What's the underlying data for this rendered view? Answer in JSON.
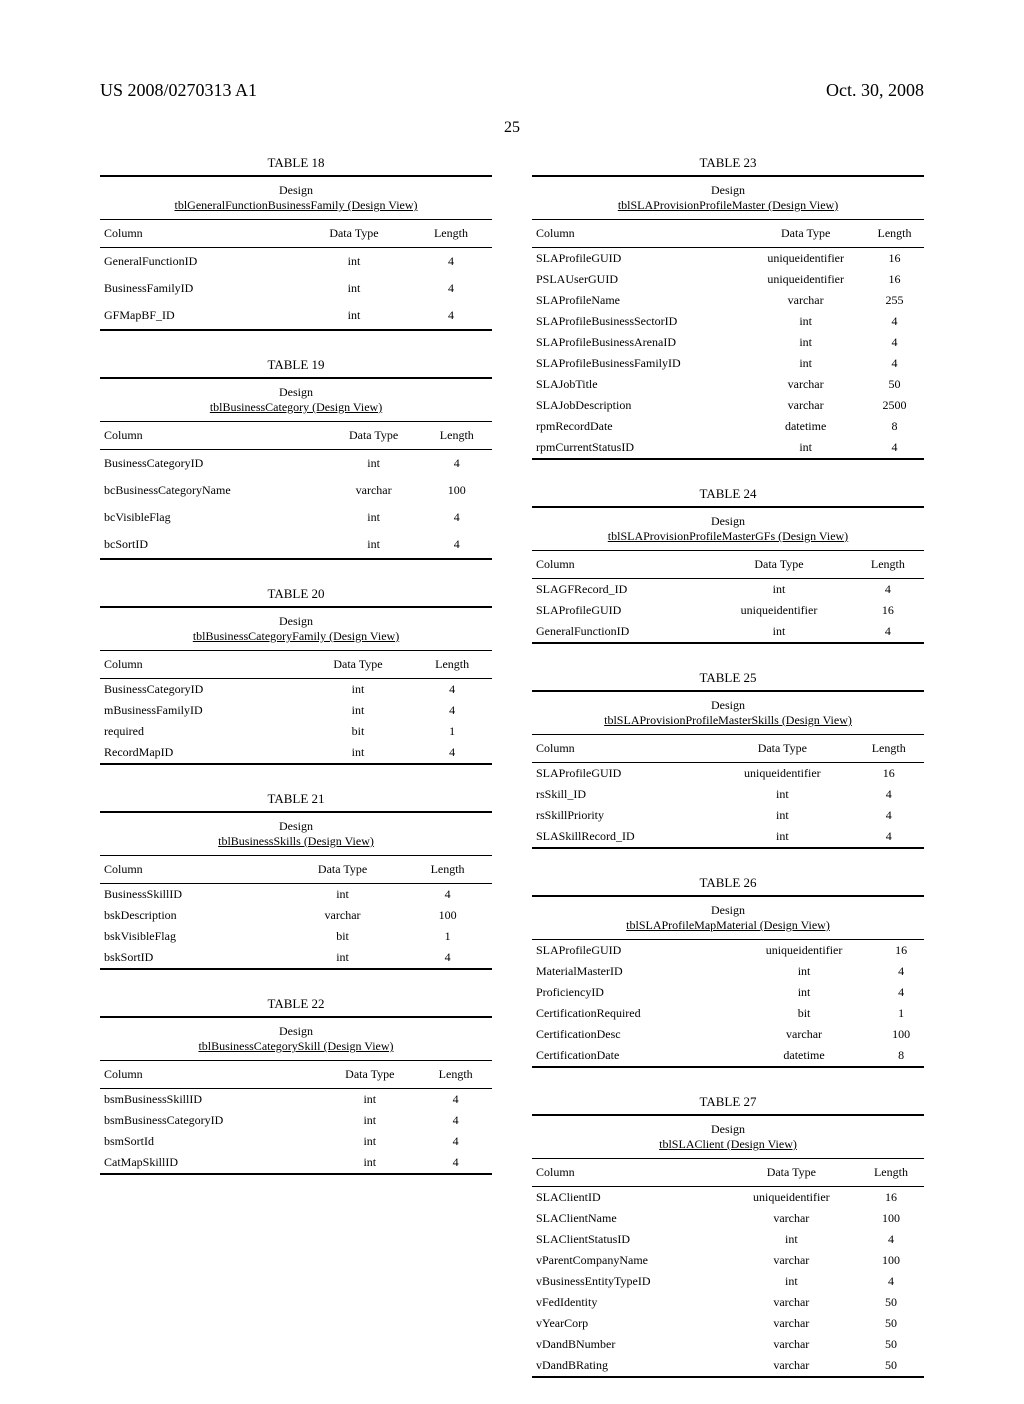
{
  "header": {
    "pub_number": "US 2008/0270313 A1",
    "pub_date": "Oct. 30, 2008",
    "page_number": "25"
  },
  "labels": {
    "design": "Design",
    "column": "Column",
    "data_type": "Data Type",
    "length": "Length"
  },
  "tables": [
    {
      "number": "TABLE 18",
      "subtitle": "tblGeneralFunctionBusinessFamily (Design View)",
      "col": "left",
      "row_padding": "loose",
      "rows": [
        {
          "c": "GeneralFunctionID",
          "t": "int",
          "l": "4"
        },
        {
          "c": "BusinessFamilyID",
          "t": "int",
          "l": "4"
        },
        {
          "c": "GFMapBF_ID",
          "t": "int",
          "l": "4"
        }
      ]
    },
    {
      "number": "TABLE 19",
      "subtitle": "tblBusinessCategory (Design View)",
      "col": "left",
      "row_padding": "loose",
      "rows": [
        {
          "c": "BusinessCategoryID",
          "t": "int",
          "l": "4"
        },
        {
          "c": "bcBusinessCategoryName",
          "t": "varchar",
          "l": "100"
        },
        {
          "c": "bcVisibleFlag",
          "t": "int",
          "l": "4"
        },
        {
          "c": "bcSortID",
          "t": "int",
          "l": "4"
        }
      ]
    },
    {
      "number": "TABLE 20",
      "subtitle": "tblBusinessCategoryFamily (Design View)",
      "col": "left",
      "row_padding": "tight",
      "rows": [
        {
          "c": "BusinessCategoryID",
          "t": "int",
          "l": "4"
        },
        {
          "c": "mBusinessFamilyID",
          "t": "int",
          "l": "4"
        },
        {
          "c": "required",
          "t": "bit",
          "l": "1"
        },
        {
          "c": "RecordMapID",
          "t": "int",
          "l": "4"
        }
      ]
    },
    {
      "number": "TABLE 21",
      "subtitle": "tblBusinessSkills (Design View)",
      "col": "left",
      "row_padding": "tight",
      "rows": [
        {
          "c": "BusinessSkillID",
          "t": "int",
          "l": "4"
        },
        {
          "c": "bskDescription",
          "t": "varchar",
          "l": "100"
        },
        {
          "c": "bskVisibleFlag",
          "t": "bit",
          "l": "1"
        },
        {
          "c": "bskSortID",
          "t": "int",
          "l": "4"
        }
      ]
    },
    {
      "number": "TABLE 22",
      "subtitle": "tblBusinessCategorySkill (Design View)",
      "col": "left",
      "row_padding": "tight",
      "rows": [
        {
          "c": "bsmBusinessSkillID",
          "t": "int",
          "l": "4"
        },
        {
          "c": "bsmBusinessCategoryID",
          "t": "int",
          "l": "4"
        },
        {
          "c": "bsmSortId",
          "t": "int",
          "l": "4"
        },
        {
          "c": "CatMapSkillID",
          "t": "int",
          "l": "4"
        }
      ]
    },
    {
      "number": "TABLE 23",
      "subtitle": "tblSLAProvisionProfileMaster (Design View)",
      "col": "right",
      "row_padding": "tight",
      "rows": [
        {
          "c": "SLAProfileGUID",
          "t": "uniqueidentifier",
          "l": "16"
        },
        {
          "c": "PSLAUserGUID",
          "t": "uniqueidentifier",
          "l": "16"
        },
        {
          "c": "SLAProfileName",
          "t": "varchar",
          "l": "255"
        },
        {
          "c": "SLAProfileBusinessSectorID",
          "t": "int",
          "l": "4"
        },
        {
          "c": "SLAProfileBusinessArenaID",
          "t": "int",
          "l": "4"
        },
        {
          "c": "SLAProfileBusinessFamilyID",
          "t": "int",
          "l": "4"
        },
        {
          "c": "SLAJobTitle",
          "t": "varchar",
          "l": "50"
        },
        {
          "c": "SLAJobDescription",
          "t": "varchar",
          "l": "2500"
        },
        {
          "c": "rpmRecordDate",
          "t": "datetime",
          "l": "8"
        },
        {
          "c": "rpmCurrentStatusID",
          "t": "int",
          "l": "4"
        }
      ]
    },
    {
      "number": "TABLE 24",
      "subtitle": "tblSLAProvisionProfileMasterGFs (Design View)",
      "col": "right",
      "row_padding": "tight",
      "rows": [
        {
          "c": "SLAGFRecord_ID",
          "t": "int",
          "l": "4"
        },
        {
          "c": "SLAProfileGUID",
          "t": "uniqueidentifier",
          "l": "16"
        },
        {
          "c": "GeneralFunctionID",
          "t": "int",
          "l": "4"
        }
      ]
    },
    {
      "number": "TABLE 25",
      "subtitle": "tblSLAProvisionProfileMasterSkills (Design View)",
      "col": "right",
      "row_padding": "tight",
      "rows": [
        {
          "c": "SLAProfileGUID",
          "t": "uniqueidentifier",
          "l": "16"
        },
        {
          "c": "rsSkill_ID",
          "t": "int",
          "l": "4"
        },
        {
          "c": "rsSkillPriority",
          "t": "int",
          "l": "4"
        },
        {
          "c": "SLASkillRecord_ID",
          "t": "int",
          "l": "4"
        }
      ]
    },
    {
      "number": "TABLE 26",
      "subtitle": "tblSLAProfileMapMaterial (Design View)",
      "col": "right",
      "row_padding": "tight",
      "no_header_row": true,
      "rows": [
        {
          "c": "SLAProfileGUID",
          "t": "uniqueidentifier",
          "l": "16"
        },
        {
          "c": "MaterialMasterID",
          "t": "int",
          "l": "4"
        },
        {
          "c": "ProficiencyID",
          "t": "int",
          "l": "4"
        },
        {
          "c": "CertificationRequired",
          "t": "bit",
          "l": "1"
        },
        {
          "c": "CertificationDesc",
          "t": "varchar",
          "l": "100"
        },
        {
          "c": "CertificationDate",
          "t": "datetime",
          "l": "8"
        }
      ]
    },
    {
      "number": "TABLE 27",
      "subtitle": "tblSLAClient (Design View)",
      "col": "right",
      "row_padding": "tight",
      "rows": [
        {
          "c": "SLAClientID",
          "t": "uniqueidentifier",
          "l": "16"
        },
        {
          "c": "SLAClientName",
          "t": "varchar",
          "l": "100"
        },
        {
          "c": "SLAClientStatusID",
          "t": "int",
          "l": "4"
        },
        {
          "c": "vParentCompanyName",
          "t": "varchar",
          "l": "100"
        },
        {
          "c": "vBusinessEntityTypeID",
          "t": "int",
          "l": "4"
        },
        {
          "c": "vFedIdentity",
          "t": "varchar",
          "l": "50"
        },
        {
          "c": "vYearCorp",
          "t": "varchar",
          "l": "50"
        },
        {
          "c": "vDandBNumber",
          "t": "varchar",
          "l": "50"
        },
        {
          "c": "vDandBRating",
          "t": "varchar",
          "l": "50"
        }
      ]
    }
  ]
}
